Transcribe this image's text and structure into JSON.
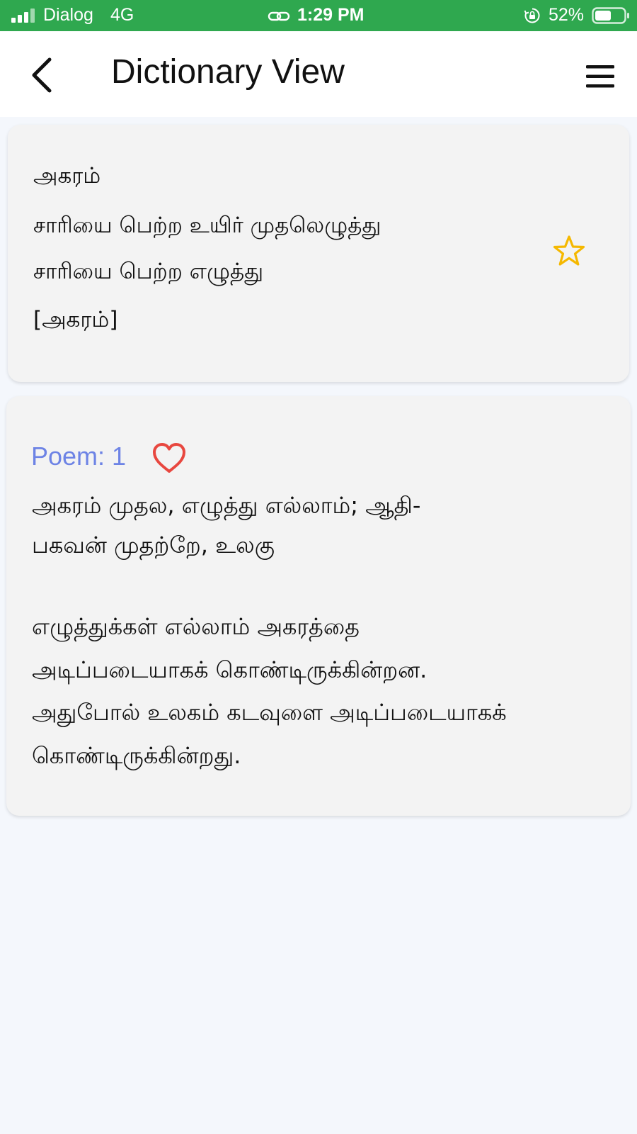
{
  "status_bar": {
    "carrier": "Dialog",
    "network": "4G",
    "time": "1:29 PM",
    "battery": "52%",
    "icons": [
      "signal-icon",
      "link-icon",
      "orientation-lock-icon",
      "battery-icon"
    ]
  },
  "header": {
    "title": "Dictionary View",
    "back_icon": "chevron-left-icon",
    "menu_icon": "hamburger-menu-icon"
  },
  "word_card": {
    "word": "அகரம்",
    "meanings": [
      "சாரியை பெற்ற உயிர் முதலெழுத்து",
      "சாரியை பெற்ற எழுத்து"
    ],
    "bracket_word": "[அகரம்]",
    "favorite_icon": "star-outline-icon",
    "favorite_color": "#f5b800"
  },
  "poem_card": {
    "label": "Poem: 1",
    "like_icon": "heart-outline-icon",
    "like_color": "#e8473f",
    "label_color": "#6d83e5",
    "verse": [
      "அகரம் முதல, எழுத்து எல்லாம்; ஆதி-",
      "பகவன் முதற்றே, உலகு"
    ],
    "explanation": [
      "எழுத்துக்கள் எல்லாம் அகரத்தை",
      "அடிப்படையாகக் கொண்டிருக்கின்றன.",
      "அதுபோல் உலகம் கடவுளை அடிப்படையாகக்",
      "கொண்டிருக்கின்றது."
    ]
  }
}
